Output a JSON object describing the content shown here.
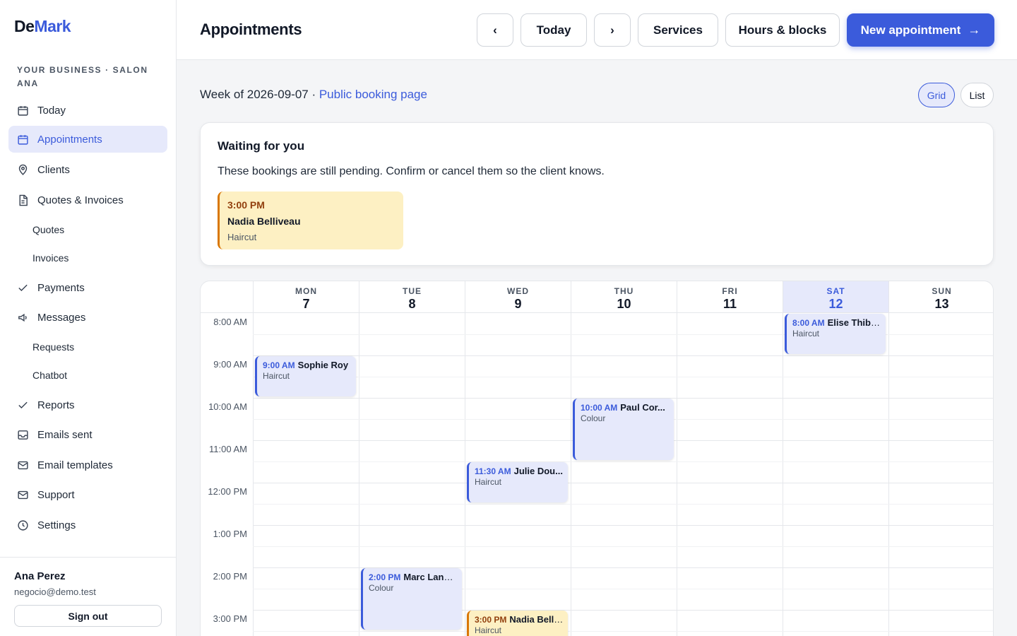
{
  "brand": {
    "part1": "De",
    "part2": "Mark"
  },
  "business_label": "YOUR BUSINESS · SALON ANA",
  "sidebar": {
    "items": [
      {
        "label": "Today",
        "icon": "calendar-icon"
      },
      {
        "label": "Appointments",
        "icon": "calendar-icon",
        "active": true
      },
      {
        "label": "Clients",
        "icon": "map-pin-icon"
      },
      {
        "label": "Quotes & Invoices",
        "icon": "document-icon"
      },
      {
        "label": "Payments",
        "icon": "check-icon"
      },
      {
        "label": "Messages",
        "icon": "megaphone-icon"
      },
      {
        "label": "Reports",
        "icon": "check-icon"
      },
      {
        "label": "Emails sent",
        "icon": "inbox-icon"
      },
      {
        "label": "Email templates",
        "icon": "mail-icon"
      },
      {
        "label": "Support",
        "icon": "mail-icon"
      },
      {
        "label": "Settings",
        "icon": "clock-icon"
      }
    ],
    "sub": {
      "quotes": "Quotes",
      "invoices": "Invoices",
      "requests": "Requests",
      "chatbot": "Chatbot"
    }
  },
  "user": {
    "name": "Ana Perez",
    "email": "negocio@demo.test",
    "signout": "Sign out"
  },
  "header": {
    "title": "Appointments",
    "prev": "‹",
    "today": "Today",
    "next": "›",
    "services": "Services",
    "hours": "Hours & blocks",
    "new_appt": "New appointment",
    "new_appt_arrow": "→"
  },
  "week": {
    "text": "Week of 2026-09-07 · ",
    "link": "Public booking page"
  },
  "view_toggle": {
    "grid": "Grid",
    "list": "List",
    "selected": "Grid"
  },
  "pending": {
    "title": "Waiting for you",
    "desc": "These bookings are still pending. Confirm or cancel them so the client knows.",
    "card": {
      "time": "3:00 PM",
      "name": "Nadia Belliveau",
      "service": "Haircut"
    }
  },
  "calendar": {
    "days": [
      {
        "name": "MON",
        "date": "7"
      },
      {
        "name": "TUE",
        "date": "8"
      },
      {
        "name": "WED",
        "date": "9"
      },
      {
        "name": "THU",
        "date": "10"
      },
      {
        "name": "FRI",
        "date": "11"
      },
      {
        "name": "SAT",
        "date": "12",
        "today": true
      },
      {
        "name": "SUN",
        "date": "13"
      }
    ],
    "hours": [
      "8:00 AM",
      "9:00 AM",
      "10:00 AM",
      "11:00 AM",
      "12:00 PM",
      "1:00 PM",
      "2:00 PM",
      "3:00 PM"
    ],
    "appointments": [
      {
        "time": "9:00 AM",
        "name": "Sophie Roy",
        "service": "Haircut",
        "day": "MON",
        "start_hour": 9.0,
        "duration_hours": 1.0,
        "status": "confirmed"
      },
      {
        "time": "2:00 PM",
        "name": "Marc Landry",
        "service": "Colour",
        "day": "TUE",
        "start_hour": 14.0,
        "duration_hours": 1.5,
        "status": "confirmed"
      },
      {
        "time": "11:30 AM",
        "name": "Julie Dou...",
        "service": "Haircut",
        "day": "WED",
        "start_hour": 11.5,
        "duration_hours": 1.0,
        "status": "confirmed"
      },
      {
        "time": "3:00 PM",
        "name": "Nadia Belli...",
        "service": "Haircut",
        "day": "WED",
        "start_hour": 15.0,
        "duration_hours": 1.0,
        "status": "pending"
      },
      {
        "time": "10:00 AM",
        "name": "Paul Cor...",
        "service": "Colour",
        "day": "THU",
        "start_hour": 10.0,
        "duration_hours": 1.5,
        "status": "confirmed"
      },
      {
        "time": "8:00 AM",
        "name": "Elise Thiba...",
        "service": "Haircut",
        "day": "SAT",
        "start_hour": 8.0,
        "duration_hours": 1.0,
        "status": "confirmed"
      }
    ]
  }
}
